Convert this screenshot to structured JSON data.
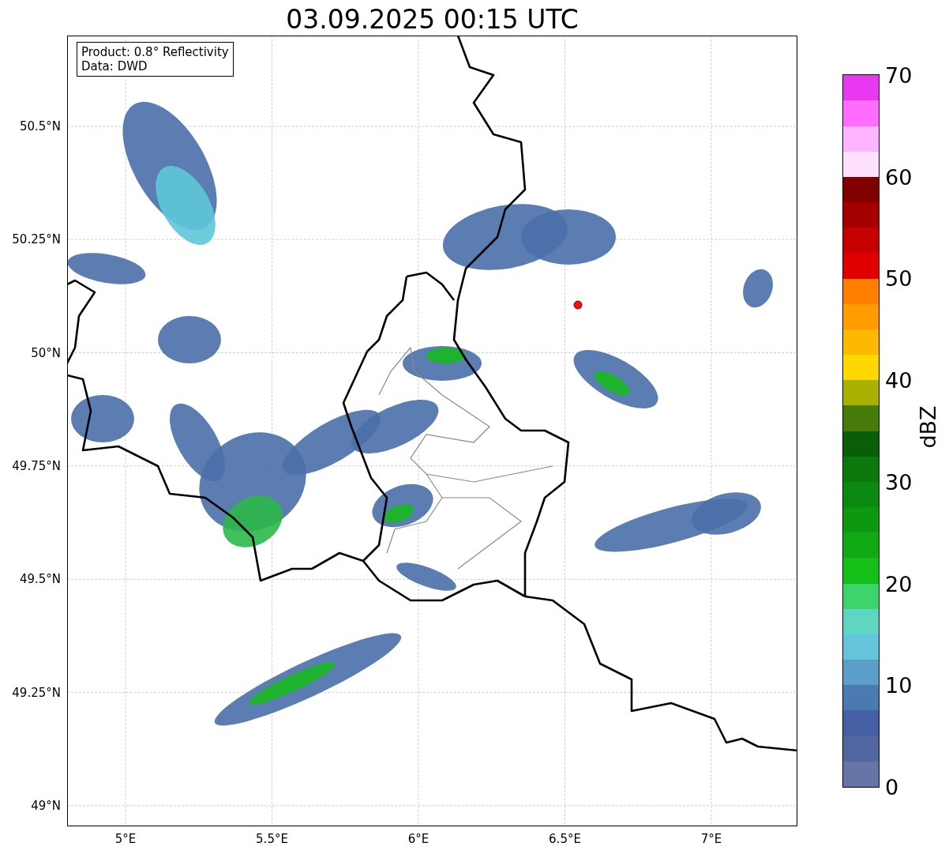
{
  "title": "03.09.2025 00:15 UTC",
  "map": {
    "info_box": [
      "Product: 0.8° Reflectivity",
      "Data: DWD"
    ],
    "xticks": [
      "5°E",
      "5.5°E",
      "6°E",
      "6.5°E",
      "7°E"
    ],
    "yticks": [
      "50.5°N",
      "50.25°N",
      "50°N",
      "49.75°N",
      "49.5°N",
      "49.25°N",
      "49°N"
    ]
  },
  "colorbar": {
    "label": "dBZ",
    "ticks": [
      "70",
      "60",
      "50",
      "40",
      "30",
      "20",
      "10",
      "0"
    ],
    "bands": [
      {
        "color": "#6674a6"
      },
      {
        "color": "#5166a0"
      },
      {
        "color": "#4560a4"
      },
      {
        "color": "#4a7ab0"
      },
      {
        "color": "#5b9ec8"
      },
      {
        "color": "#66c3dc"
      },
      {
        "color": "#5ed6c2"
      },
      {
        "color": "#3dd46e"
      },
      {
        "color": "#14c018"
      },
      {
        "color": "#10a814"
      },
      {
        "color": "#0e9810"
      },
      {
        "color": "#0b8810"
      },
      {
        "color": "#0a780c"
      },
      {
        "color": "#0a5e0a"
      },
      {
        "color": "#467a0a"
      },
      {
        "color": "#aab000"
      },
      {
        "color": "#ffd800"
      },
      {
        "color": "#ffb800"
      },
      {
        "color": "#ff9c00"
      },
      {
        "color": "#ff8000"
      },
      {
        "color": "#e00000"
      },
      {
        "color": "#c40000"
      },
      {
        "color": "#a40000"
      },
      {
        "color": "#800000"
      },
      {
        "color": "#ffe0ff"
      },
      {
        "color": "#ffb4ff"
      },
      {
        "color": "#ff6cff"
      },
      {
        "color": "#e838f0"
      }
    ]
  }
}
